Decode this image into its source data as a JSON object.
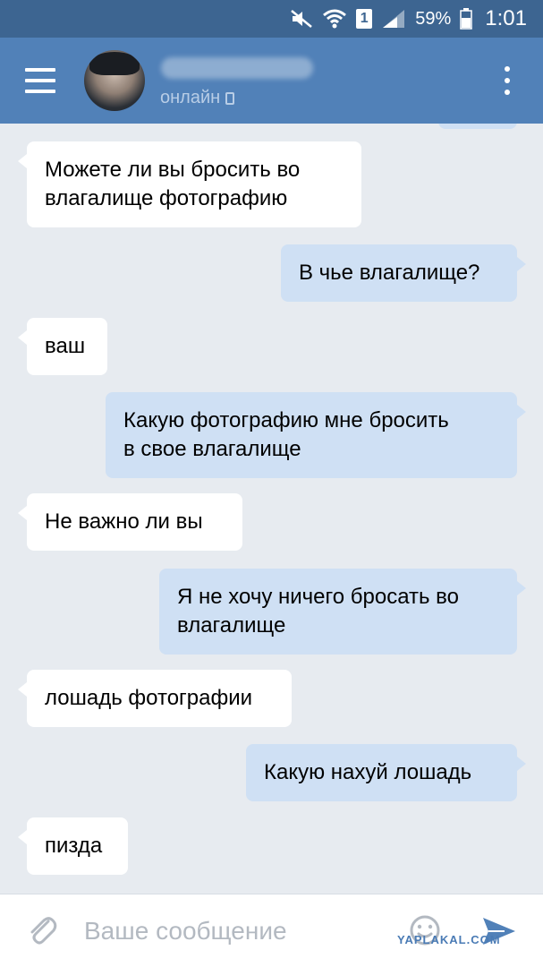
{
  "status_bar": {
    "sim_label": "1",
    "battery": "59%",
    "time": "1:01"
  },
  "header": {
    "contact_status": "онлайн",
    "icons": [
      "menu-icon",
      "avatar",
      "mobile-icon",
      "more-icon"
    ]
  },
  "messages": [
    {
      "direction": "in",
      "text_line1": "Можете ли вы бросить во",
      "text_line2": "влагалище фотографию"
    },
    {
      "direction": "out",
      "text_line1": "В чье влагалище?"
    },
    {
      "direction": "in",
      "text_line1": "ваш"
    },
    {
      "direction": "out",
      "text_line1": "Какую фотографию мне бросить",
      "text_line2": "в свое влагалище"
    },
    {
      "direction": "in",
      "text_line1": "Не важно ли вы"
    },
    {
      "direction": "out",
      "text_line1": "Я не хочу ничего бросать во",
      "text_line2": "влагалище"
    },
    {
      "direction": "in",
      "text_line1": "лошадь фотографии"
    },
    {
      "direction": "out",
      "text_line1": "Какую нахуй лошадь"
    },
    {
      "direction": "in",
      "text_line1": "пизда"
    }
  ],
  "input": {
    "placeholder": "Ваше сообщение",
    "value": ""
  },
  "watermark": "YAPLAKAL.COM",
  "colors": {
    "status_bar": "#3d6591",
    "header": "#5181b8",
    "chat_bg": "#e7ebf0",
    "incoming_bubble": "#ffffff",
    "outgoing_bubble": "#cfe0f4",
    "accent": "#5181b8"
  }
}
